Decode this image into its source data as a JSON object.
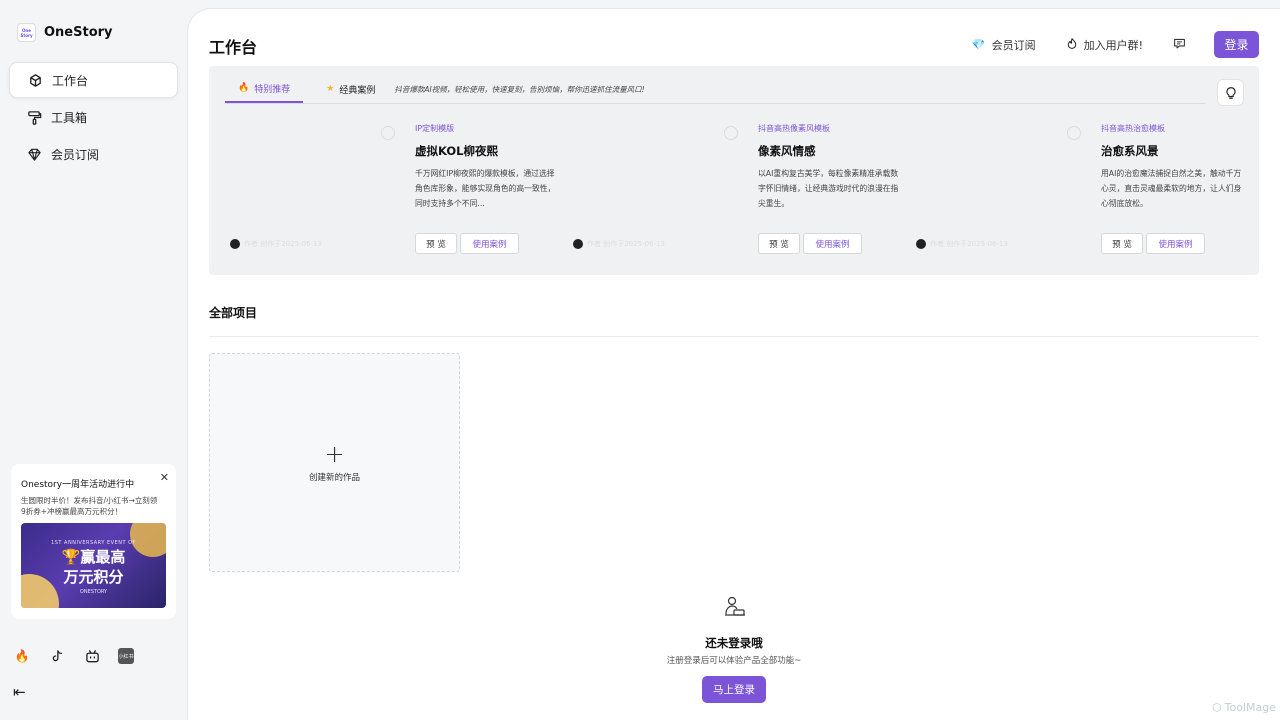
{
  "app": {
    "name": "OneStory",
    "logo_text": "One Story"
  },
  "sidebar": {
    "items": [
      {
        "label": "工作台",
        "icon": "cube-icon"
      },
      {
        "label": "工具箱",
        "icon": "paint-roller-icon"
      },
      {
        "label": "会员订阅",
        "icon": "diamond-icon"
      }
    ],
    "promo": {
      "title": "Onestory一周年活动进行中",
      "desc": "生圆限时半价！发布抖音/小红书→立刻领9折券+冲榜赢最高万元积分！",
      "banner_sup": "1ST ANNIVERSARY EVENT OF",
      "banner_big_1": "🏆赢最高",
      "banner_big_2": "万元积分",
      "banner_foot": "ONESTORY"
    },
    "social": [
      "fire-icon",
      "tiktok-icon",
      "bilibili-icon",
      "xiaohongshu-icon"
    ],
    "xhs_text": "小红书"
  },
  "header": {
    "title": "工作台",
    "membership": "会员订阅",
    "join_group": "加入用户群!",
    "login": "登录"
  },
  "feature": {
    "tabs": [
      {
        "label": "特别推荐",
        "icon": "fire-icon"
      },
      {
        "label": "经典案例",
        "icon": "star-icon"
      }
    ],
    "hint": "抖音爆款AI视频，轻松使用，快速复刻，告别烦恼，帮你迅速抓住流量风口!",
    "cards": [
      {
        "tag": "IP定制模版",
        "title": "虚拟KOL柳夜熙",
        "desc": "千万网红IP柳夜熙的爆款模板，通过选择角色库形象，能够实现角色的高一致性，同时支持多个不同...",
        "author": "作者 创作于2025-06-13"
      },
      {
        "tag": "抖音高热像素风模板",
        "title": "像素风情感",
        "desc": "以AI重构复古美学，每粒像素精准承载数字怀旧情绪，让经典游戏时代的浪漫在指尖重生。",
        "author": "作者 创作于2025-06-13"
      },
      {
        "tag": "抖音高热治愈模板",
        "title": "治愈系风景",
        "desc": "用AI的治愈魔法捕捉自然之美，触动千万心灵，直击灵魂最柔软的地方，让人们身心彻底放松。",
        "author": "作者 创作于2025-06-13"
      }
    ],
    "preview_label": "预 览",
    "case_label": "使用案例"
  },
  "projects": {
    "title": "全部项目",
    "new_label": "创建新的作品",
    "empty_title": "还未登录哦",
    "empty_desc": "注册登录后可以体验产品全部功能~",
    "empty_button": "马上登录"
  },
  "watermark": "ToolMage",
  "colors": {
    "accent": "#7b54d8",
    "sidebar_bg": "#f3f5f7",
    "feature_bg": "#f0f1f3"
  }
}
